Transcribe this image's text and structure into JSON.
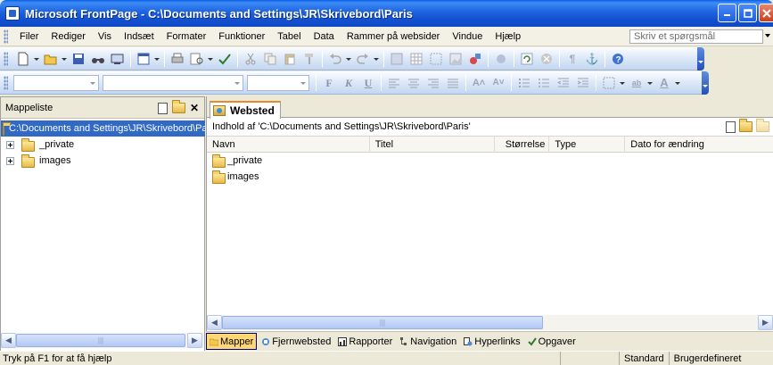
{
  "window": {
    "title": "Microsoft FrontPage - C:\\Documents and Settings\\JR\\Skrivebord\\Paris",
    "buttons": [
      "minimize",
      "maximize",
      "close"
    ]
  },
  "menubar": {
    "items": [
      "Filer",
      "Rediger",
      "Vis",
      "Indsæt",
      "Formater",
      "Funktioner",
      "Tabel",
      "Data",
      "Rammer på websider",
      "Vindue",
      "Hjælp"
    ],
    "ask_placeholder": "Skriv et spørgsmål"
  },
  "folder_pane": {
    "title": "Mappeliste",
    "root": "C:\\Documents and Settings\\JR\\Skrivebord\\Paris",
    "items": [
      "_private",
      "images"
    ]
  },
  "web": {
    "tab_label": "Websted",
    "path_label": "Indhold af 'C:\\Documents and Settings\\JR\\Skrivebord\\Paris'",
    "columns": [
      "Navn",
      "Titel",
      "Størrelse",
      "Type",
      "Dato for ændring"
    ],
    "rows": [
      "_private",
      "images"
    ]
  },
  "view_bar": {
    "items": [
      "Mapper",
      "Fjernwebsted",
      "Rapporter",
      "Navigation",
      "Hyperlinks",
      "Opgaver"
    ],
    "active": "Mapper"
  },
  "status": {
    "help": "Tryk på F1 for at få hjælp",
    "cells": [
      "Standard",
      "Brugerdefineret"
    ]
  },
  "toolbar2": {
    "bold": "F",
    "italic": "K",
    "underline": "U"
  }
}
